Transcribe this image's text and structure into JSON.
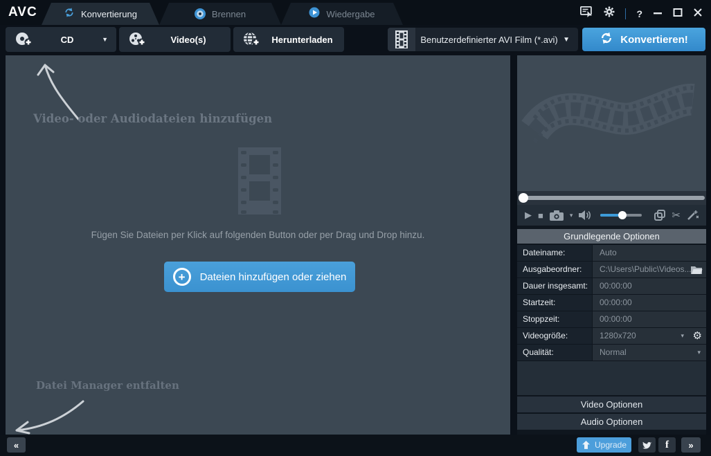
{
  "titlebar": {
    "logo": "AVC",
    "tabs": [
      {
        "label": "Konvertierung"
      },
      {
        "label": "Brennen"
      },
      {
        "label": "Wiedergabe"
      }
    ],
    "help": "?"
  },
  "toolbar": {
    "cd": "CD",
    "videos": "Video(s)",
    "download": "Herunterladen",
    "format": "Benutzerdefinierter AVI Film (*.avi)",
    "convert": "Konvertieren!"
  },
  "main": {
    "add_hint": "Video- oder Audiodateien hinzufügen",
    "drop_hint": "Fügen Sie Dateien per Klick auf folgenden Button oder per Drag und Drop hinzu.",
    "add_button": "Dateien hinzufügen oder ziehen",
    "manager_hint": "Datei Manager entfalten"
  },
  "options": {
    "title": "Grundlegende Optionen",
    "rows": [
      {
        "label": "Dateiname:",
        "value": "Auto"
      },
      {
        "label": "Ausgabeordner:",
        "value": "C:\\Users\\Public\\Videos..."
      },
      {
        "label": "Dauer insgesamt:",
        "value": "00:00:00"
      },
      {
        "label": "Startzeit:",
        "value": "00:00:00"
      },
      {
        "label": "Stoppzeit:",
        "value": "00:00:00"
      },
      {
        "label": "Videogröße:",
        "value": "1280x720"
      },
      {
        "label": "Qualität:",
        "value": "Normal"
      }
    ],
    "video_section": "Video Optionen",
    "audio_section": "Audio Optionen"
  },
  "bottom": {
    "collapse": "«",
    "upgrade": "Upgrade",
    "expand": "»"
  },
  "icons": {
    "plus": "+",
    "caret_down": "▼",
    "caret_small": "▾",
    "play": "▶",
    "stop": "■",
    "gear": "⚙",
    "scissors": "✂",
    "facebook": "f"
  },
  "colors": {
    "accent_blue": "#3d9bd8",
    "titlebar_bg": "#0a1017",
    "panel_bg": "#3c4853",
    "table_label_bg": "#19222c",
    "table_value_bg": "#273039"
  }
}
